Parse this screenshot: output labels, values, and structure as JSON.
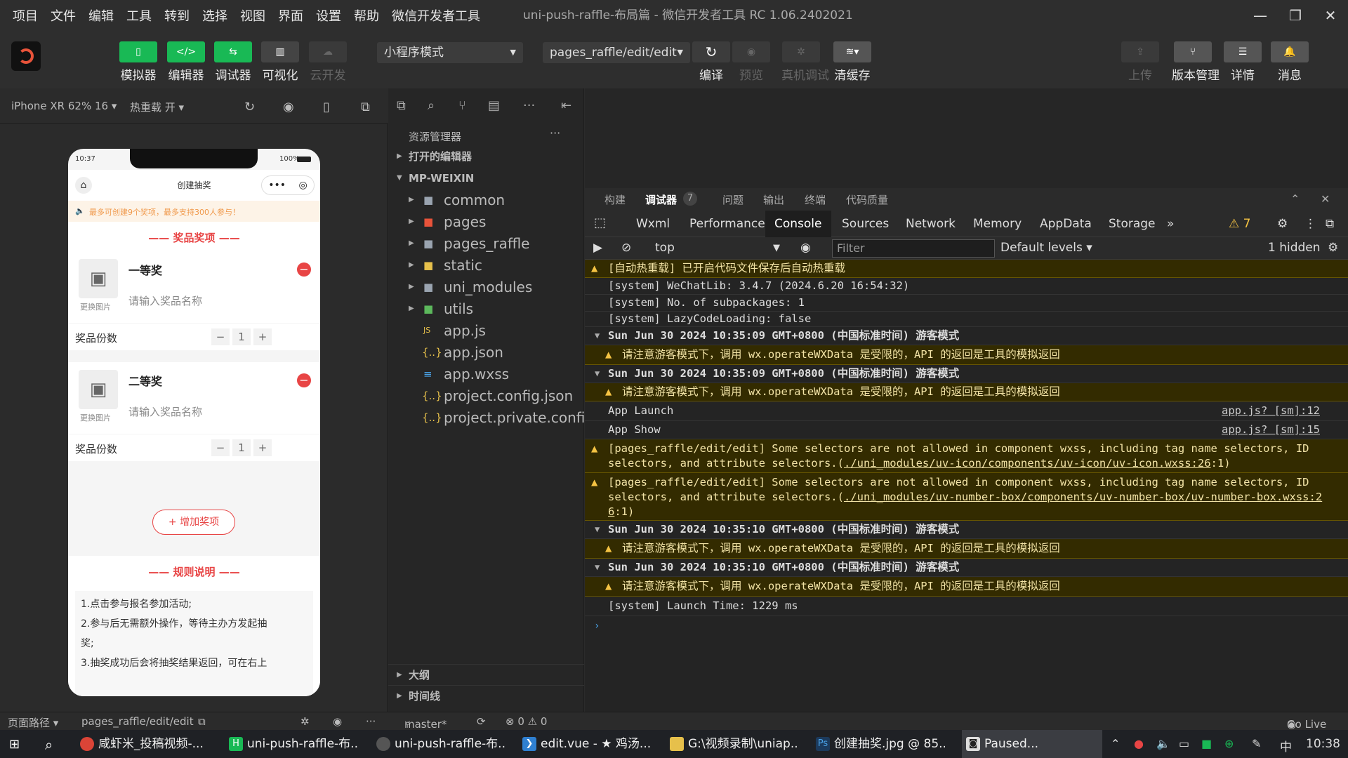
{
  "menubar": {
    "items": [
      "项目",
      "文件",
      "编辑",
      "工具",
      "转到",
      "选择",
      "视图",
      "界面",
      "设置",
      "帮助",
      "微信开发者工具"
    ],
    "title": "uni-push-raffle-布局篇 - 微信开发者工具 RC 1.06.2402021"
  },
  "toolbar": {
    "simulator": "模拟器",
    "editor": "编辑器",
    "debugger": "调试器",
    "visual": "可视化",
    "cloud": "云开发",
    "mode": "小程序模式",
    "path": "pages_raffle/edit/edit",
    "compile": "编译",
    "preview": "预览",
    "remote_debug": "真机调试",
    "clear_cache": "清缓存",
    "upload": "上传",
    "version": "版本管理",
    "details": "详情",
    "message": "消息"
  },
  "simbar": {
    "device": "iPhone XR 62% 16 ▾",
    "hotreload": "热重载 开 ▾"
  },
  "phone": {
    "time": "10:37",
    "battery": "100%",
    "nav_title": "创建抽奖",
    "notice": "最多可创建9个奖项，最多支持300人参与！",
    "section_prize": "—— 奖品奖项 ——",
    "prizes": [
      {
        "title": "一等奖",
        "change": "更换图片",
        "placeholder": "请输入奖品名称",
        "count_label": "奖品份数",
        "count": "1"
      },
      {
        "title": "二等奖",
        "change": "更换图片",
        "placeholder": "请输入奖品名称",
        "count_label": "奖品份数",
        "count": "1"
      }
    ],
    "add_button": "+ 增加奖项",
    "section_rules": "—— 规则说明 ——",
    "rules": [
      "1.点击参与报名参加活动;",
      "2.参与后无需额外操作，等待主办方发起抽",
      "奖;",
      "3.抽奖成功后会将抽奖结果返回，可在右上"
    ]
  },
  "explorer": {
    "header": "资源管理器",
    "open_editors": "打开的编辑器",
    "root": "MP-WEIXIN",
    "items": [
      "common",
      "pages",
      "pages_raffle",
      "static",
      "uni_modules",
      "utils",
      "app.js",
      "app.json",
      "app.wxss",
      "project.config.json",
      "project.private.confi..."
    ],
    "outline": "大纲",
    "timeline": "时间线"
  },
  "devtools": {
    "tabs_top": [
      "构建",
      "调试器",
      "7",
      "问题",
      "输出",
      "终端",
      "代码质量"
    ],
    "tabs": [
      "Wxml",
      "Performance",
      "Console",
      "Sources",
      "Network",
      "Memory",
      "AppData",
      "Storage",
      "»"
    ],
    "warn_count": "⚠ 7",
    "context": "top",
    "filter_placeholder": "Filter",
    "levels": "Default levels ▾",
    "hidden": "1 hidden",
    "lines": [
      "[自动热重载] 已开启代码文件保存后自动热重载",
      "[system] WeChatLib: 3.4.7 (2024.6.20 16:54:32)",
      "[system] No. of subpackages: 1",
      "[system] LazyCodeLoading: false",
      "Sun Jun 30 2024 10:35:09 GMT+0800 (中国标准时间) 游客模式",
      "请注意游客模式下，调用 wx.operateWXData 是受限的，API 的返回是工具的模拟返回",
      "Sun Jun 30 2024 10:35:09 GMT+0800 (中国标准时间) 游客模式",
      "请注意游客模式下，调用 wx.operateWXData 是受限的，API 的返回是工具的模拟返回",
      "App Launch",
      "App Show",
      "[pages_raffle/edit/edit] Some selectors are not allowed in component wxss, including tag name selectors, ID",
      "selectors, and attribute selectors.(",
      "./uni_modules/uv-icon/components/uv-icon/uv-icon.wxss:26",
      ":1)",
      "[pages_raffle/edit/edit] Some selectors are not allowed in component wxss, including tag name selectors, ID",
      "selectors, and attribute selectors.(",
      "./uni_modules/uv-number-box/components/uv-number-box/uv-number-box.wxss:2",
      "6",
      ":1)",
      "Sun Jun 30 2024 10:35:10 GMT+0800 (中国标准时间) 游客模式",
      "请注意游客模式下，调用 wx.operateWXData 是受限的，API 的返回是工具的模拟返回",
      "Sun Jun 30 2024 10:35:10 GMT+0800 (中国标准时间) 游客模式",
      "请注意游客模式下，调用 wx.operateWXData 是受限的，API 的返回是工具的模拟返回",
      "[system] Launch Time: 1229 ms"
    ],
    "src_launch": "app.js? [sm]:12",
    "src_show": "app.js? [sm]:15"
  },
  "statusbar": {
    "page_path_label": "页面路径 ▾",
    "page_path": "pages_raffle/edit/edit",
    "branch": "master*",
    "errors": "⊗ 0 ⚠ 0",
    "golive": "Go Live"
  },
  "taskbar": {
    "items": [
      "咸虾米_投稿视频-...",
      "uni-push-raffle-布...",
      "uni-push-raffle-布...",
      "edit.vue - ★ 鸡汤...",
      "G:\\视频录制\\uniap...",
      "创建抽奖.jpg @ 85...",
      "Paused..."
    ],
    "ime": "中",
    "time": "10:38"
  },
  "colors": {
    "accent_green": "#19b955",
    "warn_bg": "#332b00",
    "prize_red": "#e84545"
  }
}
